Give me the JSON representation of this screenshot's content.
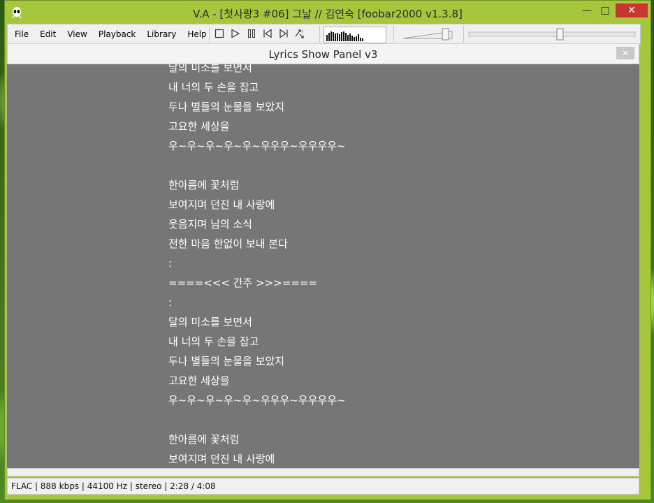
{
  "window": {
    "title": "V.A - [첫사랑3 #06] 그날 // 김연숙   [foobar2000 v1.3.8]",
    "controls": {
      "minimize": "—",
      "maximize": "□",
      "close": "✕"
    }
  },
  "menu": {
    "items": [
      {
        "label": "File"
      },
      {
        "label": "Edit"
      },
      {
        "label": "View"
      },
      {
        "label": "Playback"
      },
      {
        "label": "Library"
      },
      {
        "label": "Help"
      }
    ]
  },
  "transport": {
    "icons": [
      "stop-icon",
      "play-icon",
      "pause-icon",
      "previous-icon",
      "next-icon",
      "random-icon"
    ]
  },
  "volume": {
    "level": 0.85
  },
  "seekbar": {
    "position": 0.55
  },
  "panel": {
    "title": "Lyrics Show Panel v3",
    "close_label": "✕"
  },
  "lyrics": {
    "lines": [
      "달의 미소를 보면서",
      "내 너의 두 손을 잡고",
      "두나 별들의 눈물을 보았지",
      "고요한 세상을",
      "우~우~우~우~우~우우우~우우우우~",
      "",
      "한아름에 꽃처럼",
      "보여지며 던진 내 사랑에",
      "웃음지며 님의 소식",
      "전한 마음 한없이 보내 본다",
      ":",
      "====<<< 간주 >>>====",
      ":",
      "달의 미소를 보면서",
      "내 너의 두 손을 잡고",
      "두나 별들의 눈물을 보았지",
      "고요한 세상을",
      "우~우~우~우~우~우우우~우우우우~",
      "",
      "한아름에 꽃처럼",
      "보여지며 던진 내 사랑에"
    ]
  },
  "status": {
    "text": "FLAC | 888 kbps | 44100 Hz | stereo | 2:28 / 4:08"
  },
  "colors": {
    "frame": "#a6c63c",
    "lyrics_bg": "#767676",
    "lyrics_text": "#ffffff",
    "close_button": "#c7372f"
  }
}
